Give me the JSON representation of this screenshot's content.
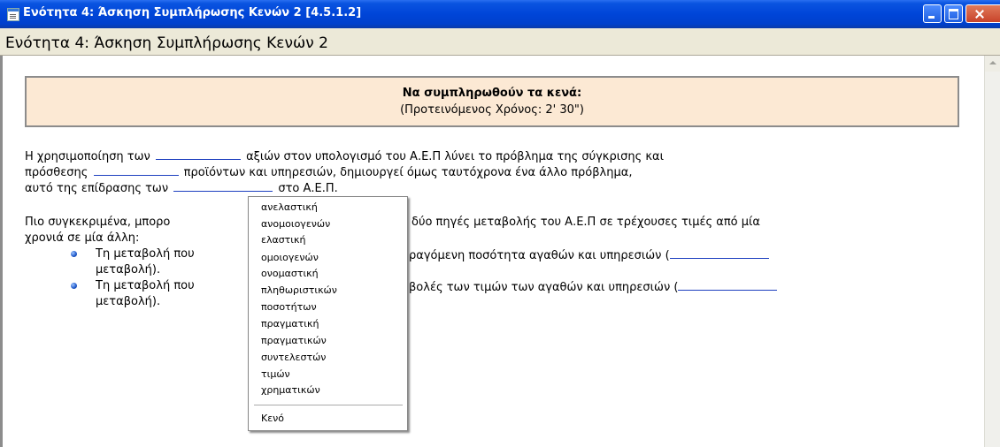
{
  "window": {
    "title": "Ενότητα 4: Άσκηση Συμπλήρωσης Κενών 2   [4.5.1.2]",
    "header": "Ενότητα 4: Άσκηση Συμπλήρωσης Κενών 2"
  },
  "instructions": {
    "heading": "Να συμπληρωθούν τα κενά:",
    "subheading": "(Προτεινόμενος Χρόνος: 2' 30\")"
  },
  "paragraph1": {
    "l1a": "Η χρησιμοποίηση των",
    "l1b": "αξιών στον υπολογισμό του Α.Ε.Π λύνει το πρόβλημα της σύγκρισης και",
    "l2a": "πρόσθεσης",
    "l2b": "προϊόντων και υπηρεσιών, δημιουργεί όμως ταυτόχρονα ένα άλλο πρόβλημα,",
    "l3a": "αυτό της επίδρασης των",
    "l3b": "στο Α.Ε.Π."
  },
  "paragraph2": {
    "l1a": "Πιο συγκεκριμένα, μπορο",
    "l1b": "δύο πηγές μεταβολής του Α.Ε.Π σε τρέχουσες τιμές από μία",
    "l2": "χρονιά σε μία άλλη:",
    "b1a": "Τη μεταβολή που",
    "b1b": "ραγόμενη ποσότητα αγαθών και υπηρεσιών (",
    "b1c": "μεταβολή).",
    "b2a": "Τη μεταβολή που",
    "b2b": "βολές των τιμών των αγαθών και υπηρεσιών (",
    "b2c": "μεταβολή)."
  },
  "dropdown": {
    "options": [
      "ανελαστική",
      "ανομοιογενών",
      "ελαστική",
      "ομοιογενών",
      "ονομαστική",
      "πληθωριστικών",
      "ποσοτήτων",
      "πραγματική",
      "πραγματικών",
      "συντελεστών",
      "τιμών",
      "χρηματικών"
    ],
    "empty_option": "Κενό"
  }
}
